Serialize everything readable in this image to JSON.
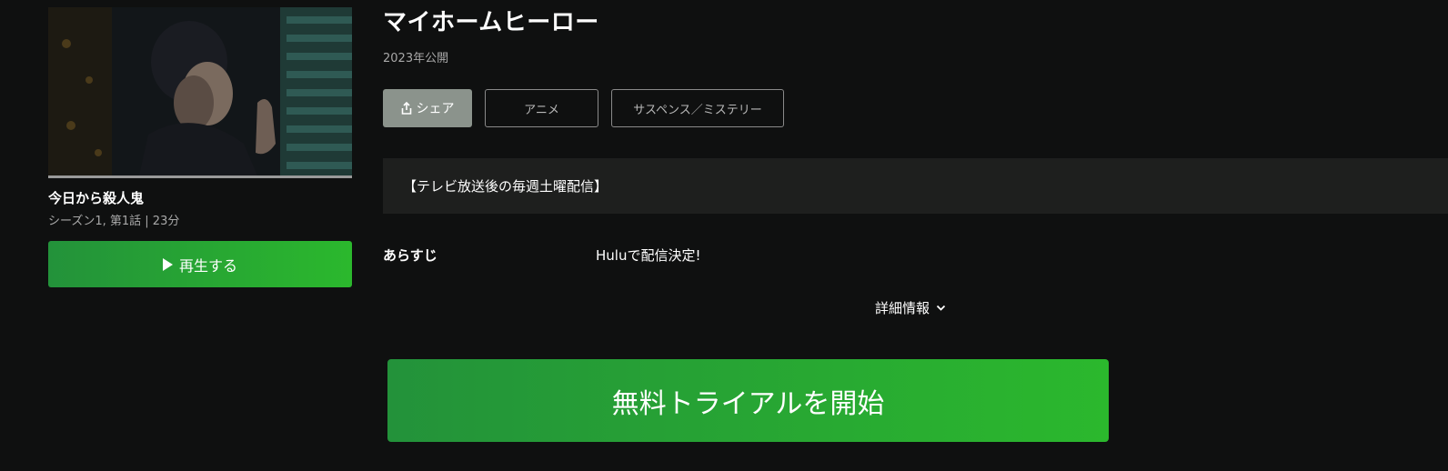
{
  "show": {
    "title": "マイホームヒーロー",
    "release": "2023年公開",
    "notice": "【テレビ放送後の毎週土曜配信】",
    "synopsis_label": "あらすじ",
    "synopsis_text": "Huluで配信決定!",
    "details_label": "詳細情報"
  },
  "actions": {
    "share_label": "シェア",
    "play_label": "再生する",
    "trial_label": "無料トライアルを開始"
  },
  "tags": [
    "アニメ",
    "サスペンス／ミステリー"
  ],
  "episode": {
    "title": "今日から殺人鬼",
    "meta": "シーズン1, 第1話 | 23分",
    "progress": 1.0
  },
  "colors": {
    "background": "#0f1010",
    "accent_green": "#2bb82d",
    "share_bg": "#8b938c",
    "notice_bg": "#1e1f1e"
  },
  "icons": {
    "share": "share-upload-icon",
    "play": "play-triangle-icon",
    "details": "chevron-down-icon"
  }
}
